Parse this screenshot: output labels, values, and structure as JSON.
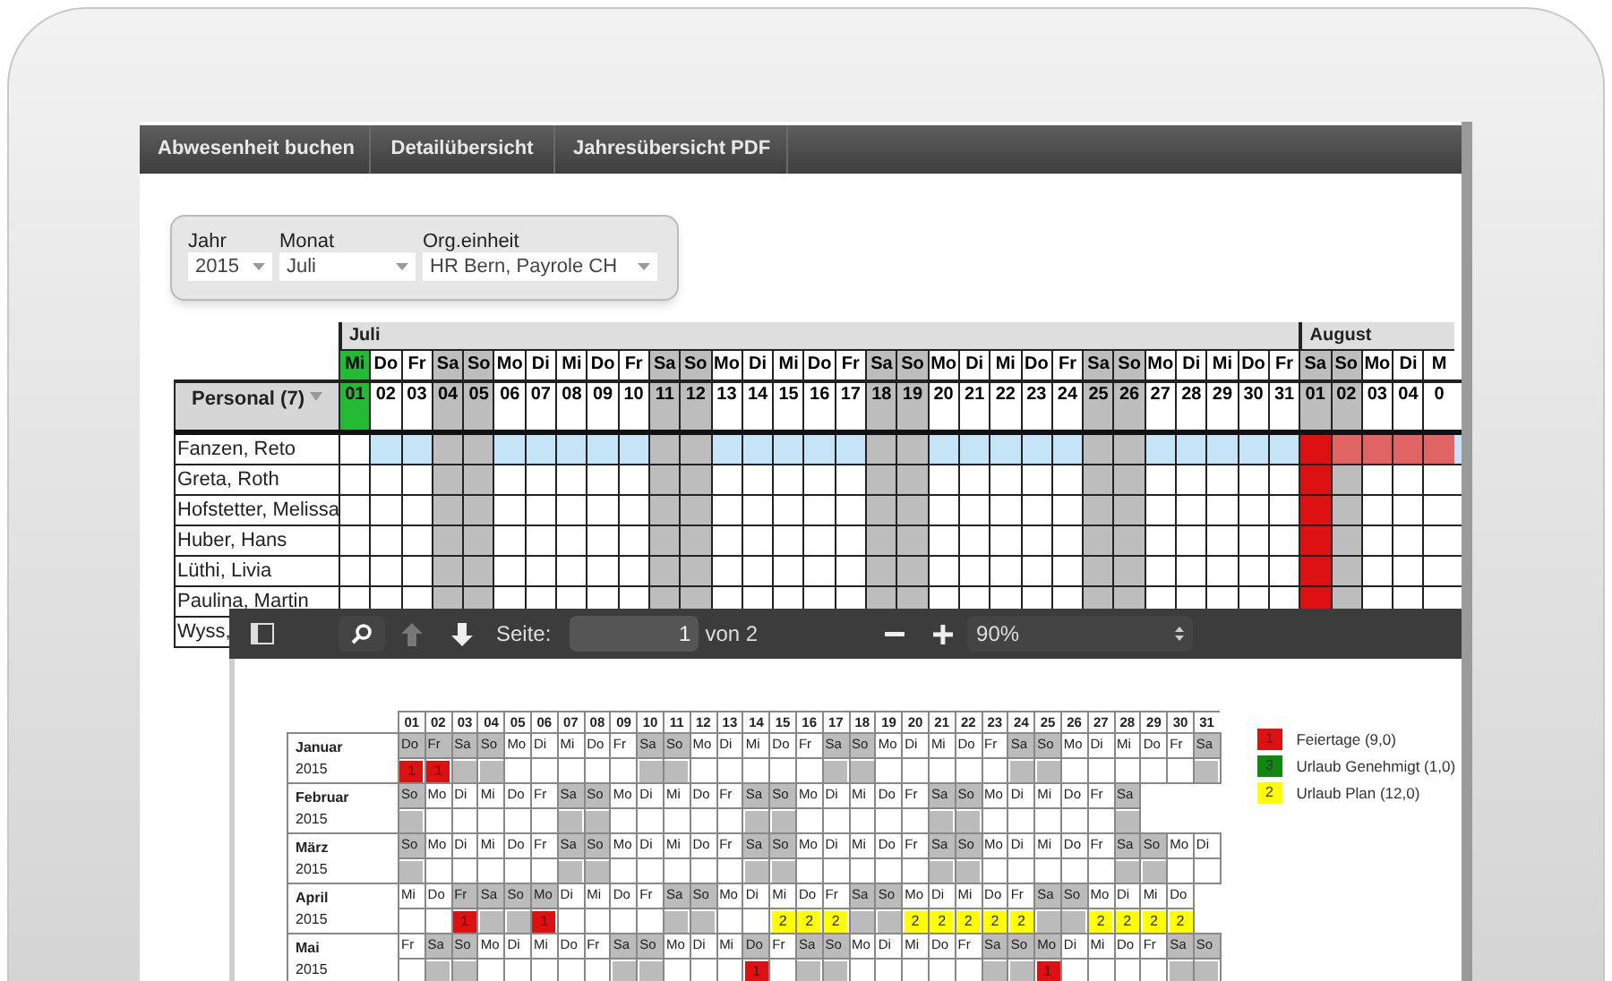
{
  "nav": {
    "tabs": [
      "Abwesenheit buchen",
      "Detailübersicht",
      "Jahresübersicht PDF"
    ]
  },
  "filter": {
    "fields": [
      {
        "label": "Jahr",
        "value": "2015"
      },
      {
        "label": "Monat",
        "value": "Juli"
      },
      {
        "label": "Org.einheit",
        "value": "HR Bern, Payrole CH"
      }
    ]
  },
  "calendar": {
    "personal_header": "Personal (7)",
    "months": [
      {
        "name": "Juli",
        "columns": [
          {
            "day": "Mi",
            "date": "01",
            "kind": "today"
          },
          {
            "day": "Do",
            "date": "02",
            "kind": "workday"
          },
          {
            "day": "Fr",
            "date": "03",
            "kind": "workday"
          },
          {
            "day": "Sa",
            "date": "04",
            "kind": "weekend"
          },
          {
            "day": "So",
            "date": "05",
            "kind": "weekend"
          },
          {
            "day": "Mo",
            "date": "06",
            "kind": "workday"
          },
          {
            "day": "Di",
            "date": "07",
            "kind": "workday"
          },
          {
            "day": "Mi",
            "date": "08",
            "kind": "workday"
          },
          {
            "day": "Do",
            "date": "09",
            "kind": "workday"
          },
          {
            "day": "Fr",
            "date": "10",
            "kind": "workday"
          },
          {
            "day": "Sa",
            "date": "11",
            "kind": "weekend"
          },
          {
            "day": "So",
            "date": "12",
            "kind": "weekend"
          },
          {
            "day": "Mo",
            "date": "13",
            "kind": "workday"
          },
          {
            "day": "Di",
            "date": "14",
            "kind": "workday"
          },
          {
            "day": "Mi",
            "date": "15",
            "kind": "workday"
          },
          {
            "day": "Do",
            "date": "16",
            "kind": "workday"
          },
          {
            "day": "Fr",
            "date": "17",
            "kind": "workday"
          },
          {
            "day": "Sa",
            "date": "18",
            "kind": "weekend"
          },
          {
            "day": "So",
            "date": "19",
            "kind": "weekend"
          },
          {
            "day": "Mo",
            "date": "20",
            "kind": "workday"
          },
          {
            "day": "Di",
            "date": "21",
            "kind": "workday"
          },
          {
            "day": "Mi",
            "date": "22",
            "kind": "workday"
          },
          {
            "day": "Do",
            "date": "23",
            "kind": "workday"
          },
          {
            "day": "Fr",
            "date": "24",
            "kind": "workday"
          },
          {
            "day": "Sa",
            "date": "25",
            "kind": "weekend"
          },
          {
            "day": "So",
            "date": "26",
            "kind": "weekend"
          },
          {
            "day": "Mo",
            "date": "27",
            "kind": "workday"
          },
          {
            "day": "Di",
            "date": "28",
            "kind": "workday"
          },
          {
            "day": "Mi",
            "date": "29",
            "kind": "workday"
          },
          {
            "day": "Do",
            "date": "30",
            "kind": "workday"
          },
          {
            "day": "Fr",
            "date": "31",
            "kind": "workday"
          }
        ]
      },
      {
        "name": "August",
        "columns": [
          {
            "day": "Sa",
            "date": "01",
            "kind": "holiday"
          },
          {
            "day": "So",
            "date": "02",
            "kind": "weekend"
          },
          {
            "day": "Mo",
            "date": "03",
            "kind": "workday"
          },
          {
            "day": "Di",
            "date": "04",
            "kind": "workday"
          },
          {
            "day": "M",
            "date": "0",
            "kind": "workday"
          }
        ]
      }
    ],
    "rows": [
      {
        "name": "Fanzen, Reto",
        "selected": true,
        "cells": [
          {
            "kind": "open"
          },
          {
            "kind": "open"
          },
          {
            "kind": "open"
          },
          {
            "kind": "open"
          },
          {
            "kind": "open"
          },
          {
            "kind": "open"
          },
          {
            "kind": "open"
          },
          {
            "kind": "open"
          },
          {
            "kind": "open"
          },
          {
            "kind": "open"
          },
          {
            "kind": "open"
          },
          {
            "kind": "open"
          },
          {
            "kind": "open"
          },
          {
            "kind": "open"
          },
          {
            "kind": "open"
          },
          {
            "kind": "open"
          },
          {
            "kind": "open"
          },
          {
            "kind": "open"
          },
          {
            "kind": "open"
          },
          {
            "kind": "open"
          },
          {
            "kind": "open"
          },
          {
            "kind": "open"
          },
          {
            "kind": "open"
          },
          {
            "kind": "open"
          },
          {
            "kind": "open"
          },
          {
            "kind": "open"
          },
          {
            "kind": "open"
          },
          {
            "kind": "open"
          },
          {
            "kind": "open"
          },
          {
            "kind": "open"
          },
          {
            "kind": "open"
          },
          {
            "kind": "open"
          },
          {
            "kind": "absent"
          },
          {
            "kind": "absent"
          },
          {
            "kind": "absent"
          },
          {
            "kind": "absent"
          }
        ]
      },
      {
        "name": "Greta, Roth",
        "selected": false,
        "cells": [
          {
            "kind": "open"
          },
          {
            "kind": "open"
          },
          {
            "kind": "open"
          },
          {
            "kind": "open"
          },
          {
            "kind": "open"
          },
          {
            "kind": "open"
          },
          {
            "kind": "open"
          },
          {
            "kind": "open"
          },
          {
            "kind": "open"
          },
          {
            "kind": "open"
          },
          {
            "kind": "open"
          },
          {
            "kind": "open"
          },
          {
            "kind": "open"
          },
          {
            "kind": "open"
          },
          {
            "kind": "open"
          },
          {
            "kind": "open"
          },
          {
            "kind": "open"
          },
          {
            "kind": "open"
          },
          {
            "kind": "open"
          },
          {
            "kind": "open"
          },
          {
            "kind": "open"
          },
          {
            "kind": "open"
          },
          {
            "kind": "open"
          },
          {
            "kind": "open"
          },
          {
            "kind": "open"
          },
          {
            "kind": "open"
          },
          {
            "kind": "open"
          },
          {
            "kind": "open"
          },
          {
            "kind": "open"
          },
          {
            "kind": "open"
          },
          {
            "kind": "open"
          },
          {
            "kind": "open"
          },
          {
            "kind": "open"
          },
          {
            "kind": "open"
          },
          {
            "kind": "open"
          },
          {
            "kind": "open"
          }
        ]
      },
      {
        "name": "Hofstetter, Melissa",
        "selected": false,
        "cells": [
          {
            "kind": "open"
          },
          {
            "kind": "open"
          },
          {
            "kind": "open"
          },
          {
            "kind": "open"
          },
          {
            "kind": "open"
          },
          {
            "kind": "open"
          },
          {
            "kind": "open"
          },
          {
            "kind": "open"
          },
          {
            "kind": "open"
          },
          {
            "kind": "open"
          },
          {
            "kind": "open"
          },
          {
            "kind": "open"
          },
          {
            "kind": "open"
          },
          {
            "kind": "open"
          },
          {
            "kind": "open"
          },
          {
            "kind": "open"
          },
          {
            "kind": "open"
          },
          {
            "kind": "open"
          },
          {
            "kind": "open"
          },
          {
            "kind": "open"
          },
          {
            "kind": "open"
          },
          {
            "kind": "open"
          },
          {
            "kind": "open"
          },
          {
            "kind": "open"
          },
          {
            "kind": "open"
          },
          {
            "kind": "open"
          },
          {
            "kind": "open"
          },
          {
            "kind": "open"
          },
          {
            "kind": "open"
          },
          {
            "kind": "open"
          },
          {
            "kind": "open"
          },
          {
            "kind": "open"
          },
          {
            "kind": "open"
          },
          {
            "kind": "open"
          },
          {
            "kind": "open"
          },
          {
            "kind": "open"
          }
        ]
      },
      {
        "name": "Huber, Hans",
        "selected": false,
        "cells": [
          {
            "kind": "open"
          },
          {
            "kind": "open"
          },
          {
            "kind": "open"
          },
          {
            "kind": "open"
          },
          {
            "kind": "open"
          },
          {
            "kind": "open"
          },
          {
            "kind": "open"
          },
          {
            "kind": "open"
          },
          {
            "kind": "open"
          },
          {
            "kind": "open"
          },
          {
            "kind": "open"
          },
          {
            "kind": "open"
          },
          {
            "kind": "open"
          },
          {
            "kind": "open"
          },
          {
            "kind": "open"
          },
          {
            "kind": "open"
          },
          {
            "kind": "open"
          },
          {
            "kind": "open"
          },
          {
            "kind": "open"
          },
          {
            "kind": "open"
          },
          {
            "kind": "open"
          },
          {
            "kind": "open"
          },
          {
            "kind": "open"
          },
          {
            "kind": "open"
          },
          {
            "kind": "open"
          },
          {
            "kind": "open"
          },
          {
            "kind": "open"
          },
          {
            "kind": "open"
          },
          {
            "kind": "open"
          },
          {
            "kind": "open"
          },
          {
            "kind": "open"
          },
          {
            "kind": "open"
          },
          {
            "kind": "open"
          },
          {
            "kind": "open"
          },
          {
            "kind": "open"
          },
          {
            "kind": "open"
          }
        ]
      },
      {
        "name": "Lüthi, Livia",
        "selected": false,
        "cells": [
          {
            "kind": "open"
          },
          {
            "kind": "open"
          },
          {
            "kind": "open"
          },
          {
            "kind": "open"
          },
          {
            "kind": "open"
          },
          {
            "kind": "open"
          },
          {
            "kind": "open"
          },
          {
            "kind": "open"
          },
          {
            "kind": "open"
          },
          {
            "kind": "open"
          },
          {
            "kind": "open"
          },
          {
            "kind": "open"
          },
          {
            "kind": "open"
          },
          {
            "kind": "open"
          },
          {
            "kind": "open"
          },
          {
            "kind": "open"
          },
          {
            "kind": "open"
          },
          {
            "kind": "open"
          },
          {
            "kind": "open"
          },
          {
            "kind": "open"
          },
          {
            "kind": "open"
          },
          {
            "kind": "open"
          },
          {
            "kind": "open"
          },
          {
            "kind": "open"
          },
          {
            "kind": "open"
          },
          {
            "kind": "open"
          },
          {
            "kind": "open"
          },
          {
            "kind": "open"
          },
          {
            "kind": "open"
          },
          {
            "kind": "open"
          },
          {
            "kind": "open"
          },
          {
            "kind": "open"
          },
          {
            "kind": "open"
          },
          {
            "kind": "open"
          },
          {
            "kind": "open"
          },
          {
            "kind": "open"
          }
        ]
      },
      {
        "name": "Paulina, Martin",
        "selected": false,
        "cells": [
          {
            "kind": "open"
          },
          {
            "kind": "open"
          },
          {
            "kind": "open"
          },
          {
            "kind": "open"
          },
          {
            "kind": "open"
          },
          {
            "kind": "open"
          },
          {
            "kind": "open"
          },
          {
            "kind": "open"
          },
          {
            "kind": "open"
          },
          {
            "kind": "open"
          },
          {
            "kind": "open"
          },
          {
            "kind": "open"
          },
          {
            "kind": "open"
          },
          {
            "kind": "open"
          },
          {
            "kind": "open"
          },
          {
            "kind": "open"
          },
          {
            "kind": "open"
          },
          {
            "kind": "open"
          },
          {
            "kind": "open"
          },
          {
            "kind": "open"
          },
          {
            "kind": "open"
          },
          {
            "kind": "open"
          },
          {
            "kind": "open"
          },
          {
            "kind": "open"
          },
          {
            "kind": "open"
          },
          {
            "kind": "open"
          },
          {
            "kind": "open"
          },
          {
            "kind": "open"
          },
          {
            "kind": "open"
          },
          {
            "kind": "open"
          },
          {
            "kind": "open"
          },
          {
            "kind": "open"
          },
          {
            "kind": "open"
          },
          {
            "kind": "open"
          },
          {
            "kind": "open"
          },
          {
            "kind": "open"
          }
        ]
      },
      {
        "name": "Wyss,"
      }
    ]
  },
  "pdf_viewer": {
    "page_label": "Seite:",
    "page": "1",
    "page_total": "von 2",
    "zoom": "90%",
    "previous_disabled": true,
    "dates": [
      "01",
      "02",
      "03",
      "04",
      "05",
      "06",
      "07",
      "08",
      "09",
      "10",
      "11",
      "12",
      "13",
      "14",
      "15",
      "16",
      "17",
      "18",
      "19",
      "20",
      "21",
      "22",
      "23",
      "24",
      "25",
      "26",
      "27",
      "28",
      "29",
      "30",
      "31"
    ],
    "months": [
      {
        "name": "Januar",
        "year": "2015",
        "days": [
          "Do",
          "Fr",
          "Sa",
          "So",
          "Mo",
          "Di",
          "Mi",
          "Do",
          "Fr",
          "Sa",
          "So",
          "Mo",
          "Di",
          "Mi",
          "Do",
          "Fr",
          "Sa",
          "So",
          "Mo",
          "Di",
          "Mi",
          "Do",
          "Fr",
          "Sa",
          "So",
          "Mo",
          "Di",
          "Mi",
          "Do",
          "Fr",
          "Sa"
        ],
        "cells": [
          {
            "kind": "holiday",
            "code": "1"
          },
          {
            "kind": "holiday",
            "code": "1"
          },
          {
            "kind": "weekend"
          },
          {
            "kind": "weekend"
          },
          {
            "kind": "work"
          },
          {
            "kind": "work"
          },
          {
            "kind": "work"
          },
          {
            "kind": "work"
          },
          {
            "kind": "work"
          },
          {
            "kind": "weekend"
          },
          {
            "kind": "weekend"
          },
          {
            "kind": "work"
          },
          {
            "kind": "work"
          },
          {
            "kind": "work"
          },
          {
            "kind": "work"
          },
          {
            "kind": "work"
          },
          {
            "kind": "weekend"
          },
          {
            "kind": "weekend"
          },
          {
            "kind": "work"
          },
          {
            "kind": "work"
          },
          {
            "kind": "work"
          },
          {
            "kind": "work"
          },
          {
            "kind": "work"
          },
          {
            "kind": "weekend"
          },
          {
            "kind": "weekend"
          },
          {
            "kind": "work"
          },
          {
            "kind": "work"
          },
          {
            "kind": "work"
          },
          {
            "kind": "work"
          },
          {
            "kind": "work"
          },
          {
            "kind": "weekend"
          }
        ]
      },
      {
        "name": "Februar",
        "year": "2015",
        "days": [
          "So",
          "Mo",
          "Di",
          "Mi",
          "Do",
          "Fr",
          "Sa",
          "So",
          "Mo",
          "Di",
          "Mi",
          "Do",
          "Fr",
          "Sa",
          "So",
          "Mo",
          "Di",
          "Mi",
          "Do",
          "Fr",
          "Sa",
          "So",
          "Mo",
          "Di",
          "Mi",
          "Do",
          "Fr",
          "Sa"
        ],
        "cells": [
          {
            "kind": "weekend"
          },
          {
            "kind": "work"
          },
          {
            "kind": "work"
          },
          {
            "kind": "work"
          },
          {
            "kind": "work"
          },
          {
            "kind": "work"
          },
          {
            "kind": "weekend"
          },
          {
            "kind": "weekend"
          },
          {
            "kind": "work"
          },
          {
            "kind": "work"
          },
          {
            "kind": "work"
          },
          {
            "kind": "work"
          },
          {
            "kind": "work"
          },
          {
            "kind": "weekend"
          },
          {
            "kind": "weekend"
          },
          {
            "kind": "work"
          },
          {
            "kind": "work"
          },
          {
            "kind": "work"
          },
          {
            "kind": "work"
          },
          {
            "kind": "work"
          },
          {
            "kind": "weekend"
          },
          {
            "kind": "weekend"
          },
          {
            "kind": "work"
          },
          {
            "kind": "work"
          },
          {
            "kind": "work"
          },
          {
            "kind": "work"
          },
          {
            "kind": "work"
          },
          {
            "kind": "weekend"
          }
        ]
      },
      {
        "name": "März",
        "year": "2015",
        "days": [
          "So",
          "Mo",
          "Di",
          "Mi",
          "Do",
          "Fr",
          "Sa",
          "So",
          "Mo",
          "Di",
          "Mi",
          "Do",
          "Fr",
          "Sa",
          "So",
          "Mo",
          "Di",
          "Mi",
          "Do",
          "Fr",
          "Sa",
          "So",
          "Mo",
          "Di",
          "Mi",
          "Do",
          "Fr",
          "Sa",
          "So",
          "Mo",
          "Di"
        ],
        "cells": [
          {
            "kind": "weekend"
          },
          {
            "kind": "work"
          },
          {
            "kind": "work"
          },
          {
            "kind": "work"
          },
          {
            "kind": "work"
          },
          {
            "kind": "work"
          },
          {
            "kind": "weekend"
          },
          {
            "kind": "weekend"
          },
          {
            "kind": "work"
          },
          {
            "kind": "work"
          },
          {
            "kind": "work"
          },
          {
            "kind": "work"
          },
          {
            "kind": "work"
          },
          {
            "kind": "weekend"
          },
          {
            "kind": "weekend"
          },
          {
            "kind": "work"
          },
          {
            "kind": "work"
          },
          {
            "kind": "work"
          },
          {
            "kind": "work"
          },
          {
            "kind": "work"
          },
          {
            "kind": "weekend"
          },
          {
            "kind": "weekend"
          },
          {
            "kind": "work"
          },
          {
            "kind": "work"
          },
          {
            "kind": "work"
          },
          {
            "kind": "work"
          },
          {
            "kind": "work"
          },
          {
            "kind": "weekend"
          },
          {
            "kind": "weekend"
          },
          {
            "kind": "work"
          },
          {
            "kind": "work"
          }
        ]
      },
      {
        "name": "April",
        "year": "2015",
        "days": [
          "Mi",
          "Do",
          "Fr",
          "Sa",
          "So",
          "Mo",
          "Di",
          "Mi",
          "Do",
          "Fr",
          "Sa",
          "So",
          "Mo",
          "Di",
          "Mi",
          "Do",
          "Fr",
          "Sa",
          "So",
          "Mo",
          "Di",
          "Mi",
          "Do",
          "Fr",
          "Sa",
          "So",
          "Mo",
          "Di",
          "Mi",
          "Do"
        ],
        "cells": [
          {
            "kind": "work"
          },
          {
            "kind": "work"
          },
          {
            "kind": "holiday",
            "code": "1"
          },
          {
            "kind": "weekend"
          },
          {
            "kind": "weekend"
          },
          {
            "kind": "holiday",
            "code": "1"
          },
          {
            "kind": "work"
          },
          {
            "kind": "work"
          },
          {
            "kind": "work"
          },
          {
            "kind": "work"
          },
          {
            "kind": "weekend"
          },
          {
            "kind": "weekend"
          },
          {
            "kind": "work"
          },
          {
            "kind": "work"
          },
          {
            "kind": "plan",
            "code": "2"
          },
          {
            "kind": "plan",
            "code": "2"
          },
          {
            "kind": "plan",
            "code": "2"
          },
          {
            "kind": "weekend"
          },
          {
            "kind": "weekend"
          },
          {
            "kind": "plan",
            "code": "2"
          },
          {
            "kind": "plan",
            "code": "2"
          },
          {
            "kind": "plan",
            "code": "2"
          },
          {
            "kind": "plan",
            "code": "2"
          },
          {
            "kind": "plan",
            "code": "2"
          },
          {
            "kind": "weekend"
          },
          {
            "kind": "weekend"
          },
          {
            "kind": "plan",
            "code": "2"
          },
          {
            "kind": "plan",
            "code": "2"
          },
          {
            "kind": "plan",
            "code": "2"
          },
          {
            "kind": "plan",
            "code": "2"
          }
        ]
      },
      {
        "name": "Mai",
        "year": "2015",
        "days": [
          "Fr",
          "Sa",
          "So",
          "Mo",
          "Di",
          "Mi",
          "Do",
          "Fr",
          "Sa",
          "So",
          "Mo",
          "Di",
          "Mi",
          "Do",
          "Fr",
          "Sa",
          "So",
          "Mo",
          "Di",
          "Mi",
          "Do",
          "Fr",
          "Sa",
          "So",
          "Mo",
          "Di",
          "Mi",
          "Do",
          "Fr",
          "Sa",
          "So"
        ],
        "cells": [
          {
            "kind": "work"
          },
          {
            "kind": "weekend"
          },
          {
            "kind": "weekend"
          },
          {
            "kind": "work"
          },
          {
            "kind": "work"
          },
          {
            "kind": "work"
          },
          {
            "kind": "work"
          },
          {
            "kind": "work"
          },
          {
            "kind": "weekend"
          },
          {
            "kind": "weekend"
          },
          {
            "kind": "work"
          },
          {
            "kind": "work"
          },
          {
            "kind": "work"
          },
          {
            "kind": "holiday",
            "code": "1"
          },
          {
            "kind": "work"
          },
          {
            "kind": "weekend"
          },
          {
            "kind": "weekend"
          },
          {
            "kind": "work"
          },
          {
            "kind": "work"
          },
          {
            "kind": "work"
          },
          {
            "kind": "work"
          },
          {
            "kind": "work"
          },
          {
            "kind": "weekend"
          },
          {
            "kind": "weekend"
          },
          {
            "kind": "holiday",
            "code": "1"
          },
          {
            "kind": "work"
          },
          {
            "kind": "work"
          },
          {
            "kind": "work"
          },
          {
            "kind": "work"
          },
          {
            "kind": "weekend"
          },
          {
            "kind": "weekend"
          }
        ]
      }
    ],
    "legend": [
      {
        "kind": "holiday",
        "code": "1",
        "label": "Feiertage (9,0)",
        "color": "#dd1111"
      },
      {
        "kind": "approved",
        "code": "3",
        "label": "Urlaub Genehmigt (1,0)",
        "color": "#118811"
      },
      {
        "kind": "plan",
        "code": "2",
        "label": "Urlaub Plan (12,0)",
        "color": "#ffff00"
      }
    ]
  }
}
